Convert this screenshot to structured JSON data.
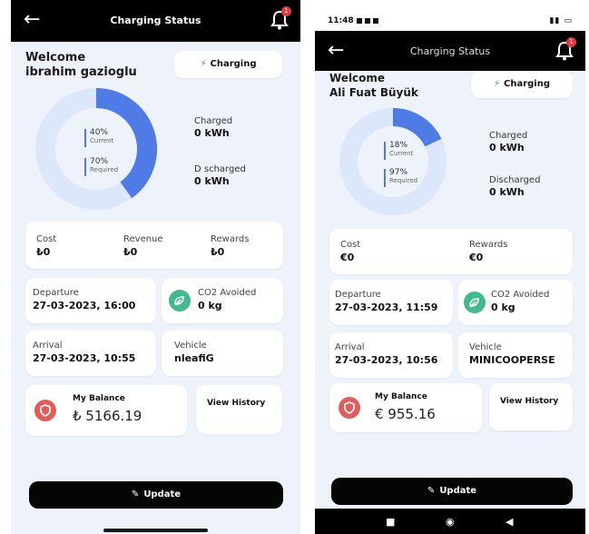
{
  "left": {
    "header": {
      "title": "Charging Status",
      "notification_count": "1"
    },
    "welcome": "Welcome",
    "user_name": "ibrahim gazioglu",
    "status_pill": "Charging",
    "donut": {
      "current_pct": "40%",
      "current_label": "Current",
      "required_pct": "70%",
      "required_label": "Required",
      "current_fraction": 0.4
    },
    "charged": {
      "label": "Charged",
      "value": "0 kWh"
    },
    "discharged": {
      "label": "D scharged",
      "value": "0 kWh"
    },
    "cost": {
      "label": "Cost",
      "value": "₺0"
    },
    "revenue": {
      "label": "Revenue",
      "value": "₺0"
    },
    "rewards": {
      "label": "Rewards",
      "value": "₺0"
    },
    "departure": {
      "label": "Departure",
      "value": "27-03-2023, 16:00"
    },
    "co2": {
      "label": "CO2 Avoided",
      "value": "0 kg"
    },
    "arrival": {
      "label": "Arrival",
      "value": "27-03-2023, 10:55"
    },
    "vehicle": {
      "label": "Vehicle",
      "value": "nleafiG"
    },
    "balance": {
      "label": "My Balance",
      "value": "₺ 5166.19"
    },
    "view_history": "View History",
    "update": "Update"
  },
  "right": {
    "statusbar": {
      "time": "11:48"
    },
    "header": {
      "title": "Charging Status",
      "notification_count": "1"
    },
    "welcome": "Welcome",
    "user_name": "Ali Fuat Büyük",
    "status_pill": "Charging",
    "donut": {
      "current_pct": "18%",
      "current_label": "Current",
      "required_pct": "97%",
      "required_label": "Required",
      "current_fraction": 0.18
    },
    "charged": {
      "label": "Charged",
      "value": "0 kWh"
    },
    "discharged": {
      "label": "Discharged",
      "value": "0 kWh"
    },
    "cost": {
      "label": "Cost",
      "value": "€0"
    },
    "rewards": {
      "label": "Rewards",
      "value": "€0"
    },
    "departure": {
      "label": "Departure",
      "value": "27-03-2023, 11:59"
    },
    "co2": {
      "label": "CO2 Avoided",
      "value": "0 kg"
    },
    "arrival": {
      "label": "Arrival",
      "value": "27-03-2023, 10:56"
    },
    "vehicle": {
      "label": "Vehicle",
      "value": "MINICOOPERSE"
    },
    "balance": {
      "label": "My Balance",
      "value": "€ 955.16"
    },
    "view_history": "View History",
    "update": "Update"
  },
  "colors": {
    "accent_blue": "#4f7be6",
    "donut_track": "#dde7fb",
    "charging_green": "#2fa844",
    "leaf_green": "#43b98e",
    "shield_red": "#e05d5d"
  }
}
